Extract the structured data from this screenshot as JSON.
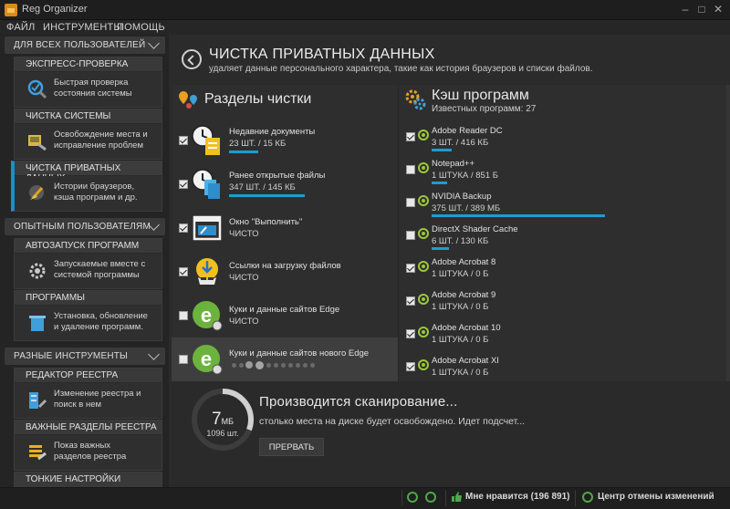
{
  "window": {
    "title": "Reg Organizer"
  },
  "menu": [
    "ФАЙЛ",
    "ИНСТРУМЕНТЫ",
    "ПОМОЩЬ"
  ],
  "sidebar": {
    "sections": [
      {
        "label": "ДЛЯ ВСЕХ ПОЛЬЗОВАТЕЛЕЙ"
      },
      {
        "label": "ОПЫТНЫМ ПОЛЬЗОВАТЕЛЯМ"
      },
      {
        "label": "РАЗНЫЕ ИНСТРУМЕНТЫ"
      }
    ],
    "tiles": [
      {
        "title": "ЭКСПРЕСС-ПРОВЕРКА",
        "line1": "Быстрая проверка",
        "line2": "состояния системы"
      },
      {
        "title": "ЧИСТКА СИСТЕМЫ",
        "line1": "Освобождение места и",
        "line2": "исправление проблем"
      },
      {
        "title": "ЧИСТКА ПРИВАТНЫХ ДАННЫХ",
        "line1": "Истории браузеров,",
        "line2": "кэша программ и др."
      },
      {
        "title": "АВТОЗАПУСК ПРОГРАММ",
        "line1": "Запускаемые вместе с",
        "line2": "системой программы"
      },
      {
        "title": "ПРОГРАММЫ",
        "line1": "Установка, обновление",
        "line2": "и удаление программ."
      },
      {
        "title": "РЕДАКТОР РЕЕСТРА",
        "line1": "Изменение реестра и",
        "line2": "поиск в нем"
      },
      {
        "title": "ВАЖНЫЕ РАЗДЕЛЫ РЕЕСТРА",
        "line1": "Показ важных",
        "line2": "разделов реестра"
      },
      {
        "title": "ТОНКИЕ НАСТРОЙКИ",
        "line1": "",
        "line2": ""
      }
    ]
  },
  "header": {
    "title": "ЧИСТКА ПРИВАТНЫХ ДАННЫХ",
    "subtitle": "удаляет данные персонального характера, такие как история браузеров и списки файлов."
  },
  "cleanup": {
    "title": "Разделы чистки",
    "items": [
      {
        "name": "Недавние документы",
        "status": "23 ШТ. / 15 КБ",
        "checked": true,
        "bar": 0.18
      },
      {
        "name": "Ранее открытые файлы",
        "status": "347 ШТ. / 145 КБ",
        "checked": true,
        "bar": 0.46
      },
      {
        "name": "Окно \"Выполнить\"",
        "status": "ЧИСТО",
        "checked": true,
        "bar": 0
      },
      {
        "name": "Ссылки на загрузку файлов",
        "status": "ЧИСТО",
        "checked": true,
        "bar": 0
      },
      {
        "name": "Куки и данные сайтов Edge",
        "status": "ЧИСТО",
        "checked": false,
        "bar": 0
      },
      {
        "name": "Куки и данные сайтов нового Edge",
        "status": "",
        "checked": false,
        "bar": 0
      }
    ]
  },
  "cache": {
    "title": "Кэш программ",
    "known": "Известных программ: 27",
    "items": [
      {
        "name": "Adobe Reader DC",
        "status": "3 ШТ. / 416 КБ",
        "checked": true,
        "bar": 0.08
      },
      {
        "name": "Notepad++",
        "status": "1 ШТУКА / 851 Б",
        "checked": false,
        "bar": 0.06
      },
      {
        "name": "NVIDIA Backup",
        "status": "375 ШТ. / 389 МБ",
        "checked": false,
        "bar": 0.69
      },
      {
        "name": "DirectX Shader Cache",
        "status": "6 ШТ. / 130 КБ",
        "checked": false,
        "bar": 0.07
      },
      {
        "name": "Adobe Acrobat 8",
        "status": "1 ШТУКА / 0 Б",
        "checked": true,
        "bar": 0
      },
      {
        "name": "Adobe Acrobat 9",
        "status": "1 ШТУКА / 0 Б",
        "checked": true,
        "bar": 0
      },
      {
        "name": "Adobe Acrobat 10",
        "status": "1 ШТУКА / 0 Б",
        "checked": true,
        "bar": 0
      },
      {
        "name": "Adobe Acrobat XI",
        "status": "1 ШТУКА / 0 Б",
        "checked": true,
        "bar": 0
      }
    ]
  },
  "scan": {
    "size_value": "7",
    "size_unit": "МБ",
    "count": "1096 шт.",
    "title": "Производится сканирование...",
    "subtitle": "столько места на диске будет освобождено. Идет подсчет...",
    "stop_label": "ПРЕРВАТЬ"
  },
  "status": {
    "like": "Мне нравится (196 891)",
    "undo": "Центр отмены изменений"
  },
  "colors": {
    "accent": "#1e9bd1",
    "green": "#9bc83a",
    "edge_green": "#6cb33e"
  }
}
